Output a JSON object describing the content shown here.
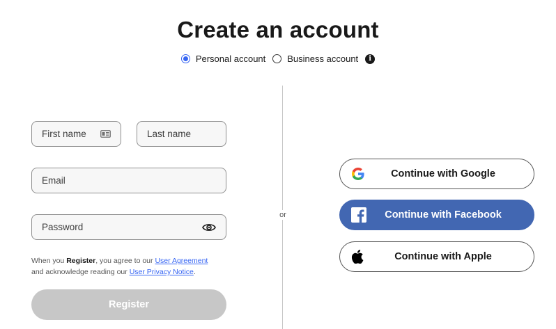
{
  "page": {
    "title": "Create an account"
  },
  "account_type": {
    "options": [
      {
        "label": "Personal account",
        "selected": true
      },
      {
        "label": "Business account",
        "selected": false
      }
    ],
    "info_icon": "info-icon",
    "info_glyph": "i"
  },
  "form": {
    "first_name": {
      "placeholder": "First name",
      "value": "",
      "icon": "contact-card-icon"
    },
    "last_name": {
      "placeholder": "Last name",
      "value": ""
    },
    "email": {
      "placeholder": "Email",
      "value": ""
    },
    "password": {
      "placeholder": "Password",
      "value": "",
      "icon": "eye-icon"
    },
    "legal": {
      "prefix": "When you ",
      "register_word": "Register",
      "middle": ", you agree to our ",
      "agreement_link": "User Agreement",
      "line2_prefix": "and acknowledge reading our ",
      "privacy_link": "User Privacy Notice",
      "suffix": "."
    },
    "register_label": "Register"
  },
  "divider": {
    "or_label": "or"
  },
  "social": {
    "google_label": "Continue with Google",
    "facebook_label": "Continue with Facebook",
    "apple_label": "Continue with Apple"
  },
  "colors": {
    "accent": "#3665f3",
    "facebook": "#4267b2",
    "register_disabled": "#c7c7c7",
    "field_bg": "#f7f7f7"
  }
}
